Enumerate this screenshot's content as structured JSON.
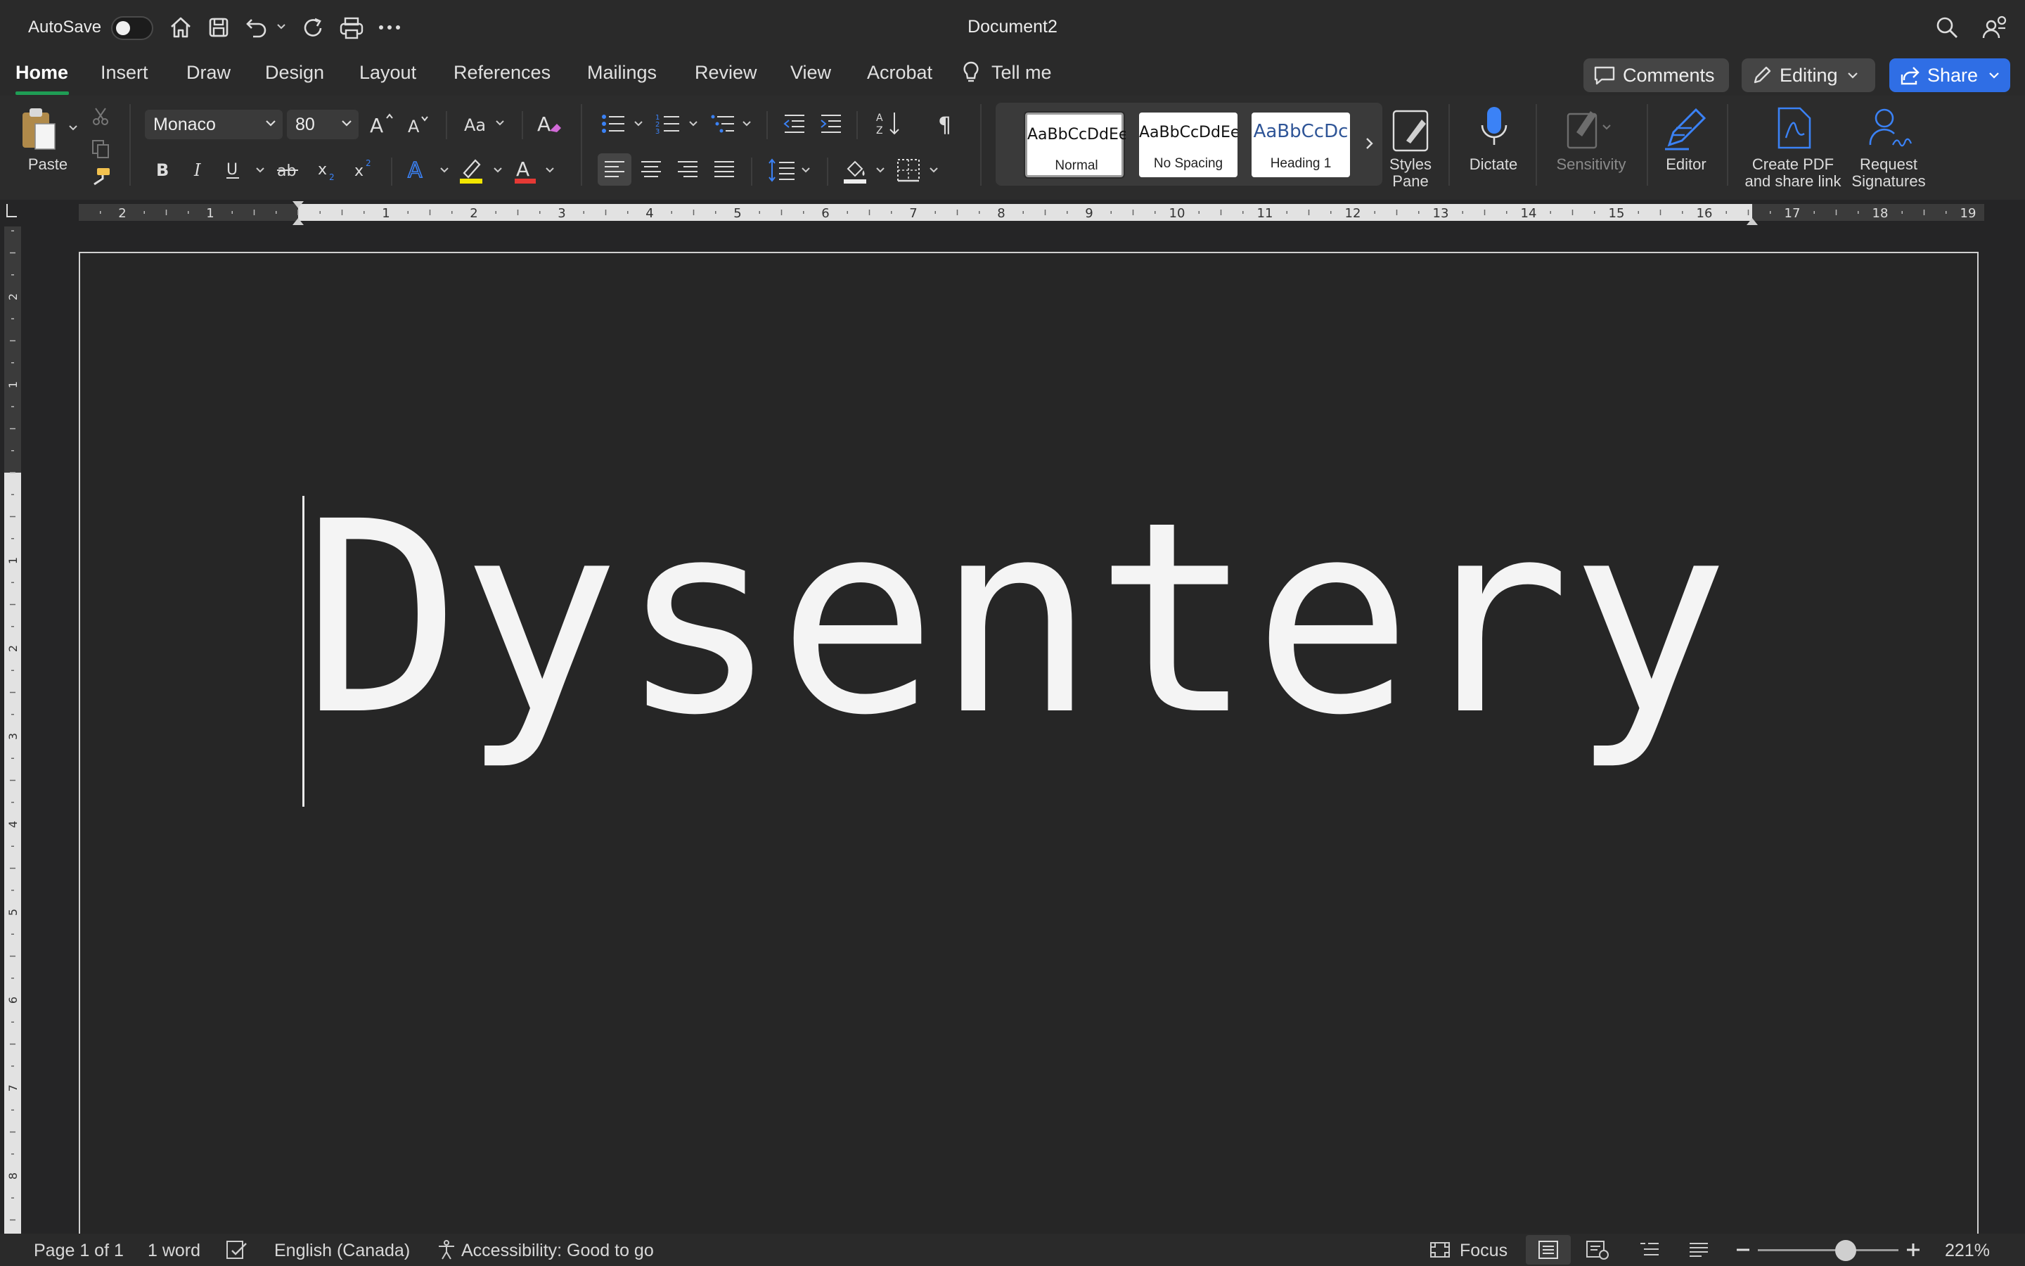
{
  "titlebar": {
    "autosave_label": "AutoSave",
    "document_title": "Document2"
  },
  "tabs": [
    {
      "label": "Home",
      "active": true
    },
    {
      "label": "Insert"
    },
    {
      "label": "Draw"
    },
    {
      "label": "Design"
    },
    {
      "label": "Layout"
    },
    {
      "label": "References"
    },
    {
      "label": "Mailings"
    },
    {
      "label": "Review"
    },
    {
      "label": "View"
    },
    {
      "label": "Acrobat"
    },
    {
      "label": "Tell me"
    }
  ],
  "actions": {
    "comments": "Comments",
    "editing": "Editing",
    "share": "Share"
  },
  "ribbon": {
    "paste_label": "Paste",
    "font_name": "Monaco",
    "font_size": "80",
    "styles": [
      {
        "sample": "AaBbCcDdEe",
        "name": "Normal"
      },
      {
        "sample": "AaBbCcDdEe",
        "name": "No Spacing"
      },
      {
        "sample": "AaBbCcDc",
        "name": "Heading 1"
      }
    ],
    "styles_pane": [
      "Styles",
      "Pane"
    ],
    "dictate": "Dictate",
    "sensitivity": "Sensitivity",
    "editor": "Editor",
    "create_pdf": [
      "Create PDF",
      "and share link"
    ],
    "request_signatures": [
      "Request",
      "Signatures"
    ]
  },
  "ruler": {
    "horizontal_labels": [
      "2",
      "1",
      "1",
      "2",
      "3",
      "4",
      "5",
      "6",
      "7",
      "8",
      "9",
      "10",
      "11",
      "12",
      "13",
      "14",
      "15",
      "16",
      "17",
      "18",
      "19"
    ],
    "vertical_labels": [
      "2",
      "1",
      "1",
      "2",
      "3",
      "4",
      "5",
      "6",
      "7",
      "8"
    ]
  },
  "document": {
    "text": "Dysentery"
  },
  "status": {
    "page": "Page 1 of 1",
    "words": "1 word",
    "language": "English (Canada)",
    "accessibility": "Accessibility: Good to go",
    "focus": "Focus",
    "zoom": "221%"
  },
  "colors": {
    "accent_green": "#1f9d55",
    "share_blue": "#2f6ee5",
    "icon_blue": "#3b82f6",
    "highlight_yellow": "#f2e600",
    "font_red": "#e53935"
  }
}
